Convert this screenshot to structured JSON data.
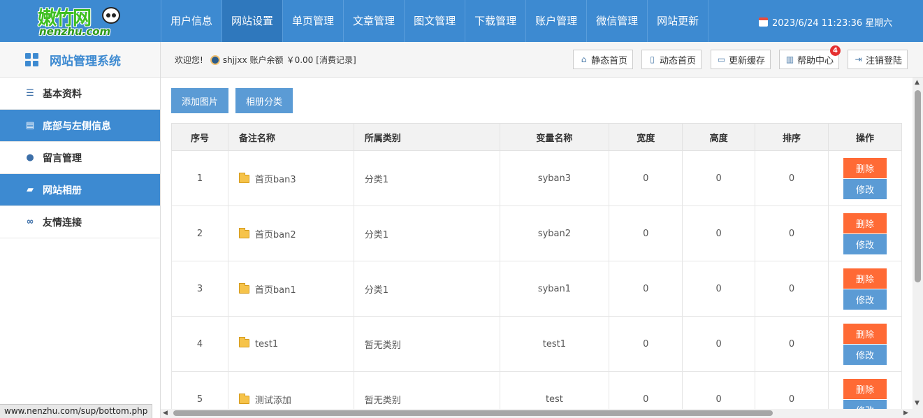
{
  "logo": {
    "cn": "嫩竹网",
    "en": "nenzhu.com"
  },
  "nav": [
    "用户信息",
    "网站设置",
    "单页管理",
    "文章管理",
    "图文管理",
    "下载管理",
    "账户管理",
    "微信管理",
    "网站更新"
  ],
  "nav_active": "网站设置",
  "datetime": "2023/6/24 11:23:36 星期六",
  "sidebar": {
    "title": "网站管理系统",
    "items": [
      {
        "label": "基本资料",
        "icon": "list-icon",
        "active": false
      },
      {
        "label": "底部与左侧信息",
        "icon": "file-icon",
        "active": true
      },
      {
        "label": "留言管理",
        "icon": "chat-icon",
        "active": false
      },
      {
        "label": "网站相册",
        "icon": "book-icon",
        "active": true
      },
      {
        "label": "友情连接",
        "icon": "link-icon",
        "active": false
      }
    ]
  },
  "infobar": {
    "welcome": "欢迎您!",
    "user": "shjjxx",
    "balance_label": "账户余额",
    "balance": "￥0.00",
    "records": "[消费记录]",
    "buttons": {
      "static_home": "静态首页",
      "dynamic_home": "动态首页",
      "refresh_cache": "更新缓存",
      "help_center": "帮助中心",
      "help_badge": "4",
      "logout": "注销登陆"
    }
  },
  "actions": {
    "add_image": "添加图片",
    "album_category": "相册分类"
  },
  "table": {
    "headers": [
      "序号",
      "备注名称",
      "所属类别",
      "变量名称",
      "宽度",
      "高度",
      "排序",
      "操作"
    ],
    "rows": [
      {
        "no": "1",
        "name": "首页ban3",
        "category": "分类1",
        "var": "syban3",
        "width": "0",
        "height": "0",
        "order": "0"
      },
      {
        "no": "2",
        "name": "首页ban2",
        "category": "分类1",
        "var": "syban2",
        "width": "0",
        "height": "0",
        "order": "0"
      },
      {
        "no": "3",
        "name": "首页ban1",
        "category": "分类1",
        "var": "syban1",
        "width": "0",
        "height": "0",
        "order": "0"
      },
      {
        "no": "4",
        "name": "test1",
        "category": "暂无类别",
        "var": "test1",
        "width": "0",
        "height": "0",
        "order": "0"
      },
      {
        "no": "5",
        "name": "测试添加",
        "category": "暂无类别",
        "var": "test",
        "width": "0",
        "height": "0",
        "order": "0"
      }
    ],
    "delete_label": "删除",
    "edit_label": "修改"
  },
  "status_url": "www.nenzhu.com/sup/bottom.php"
}
